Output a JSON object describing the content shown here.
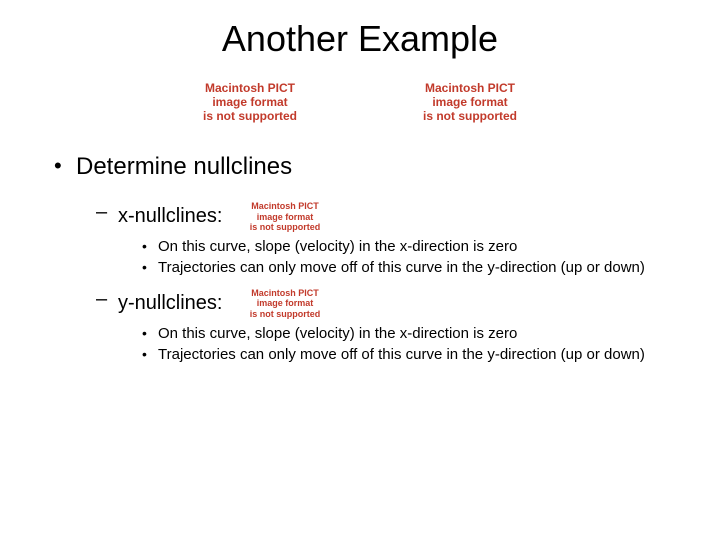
{
  "title": "Another Example",
  "pict_error": {
    "line1": "Macintosh PICT",
    "line2": "image format",
    "line3": "is not supported"
  },
  "lvl1": {
    "item1": "Determine nullclines"
  },
  "lvl2": {
    "item1": "x-nullclines:",
    "item2": "y-nullclines:"
  },
  "lvl3": {
    "a1": "On this curve, slope (velocity) in the x-direction is zero",
    "a2": "Trajectories can only move off of  this curve in the y-direction (up or down)",
    "b1": "On this curve, slope (velocity) in the x-direction is zero",
    "b2": "Trajectories can only move off of  this curve in the y-direction (up or down)"
  }
}
